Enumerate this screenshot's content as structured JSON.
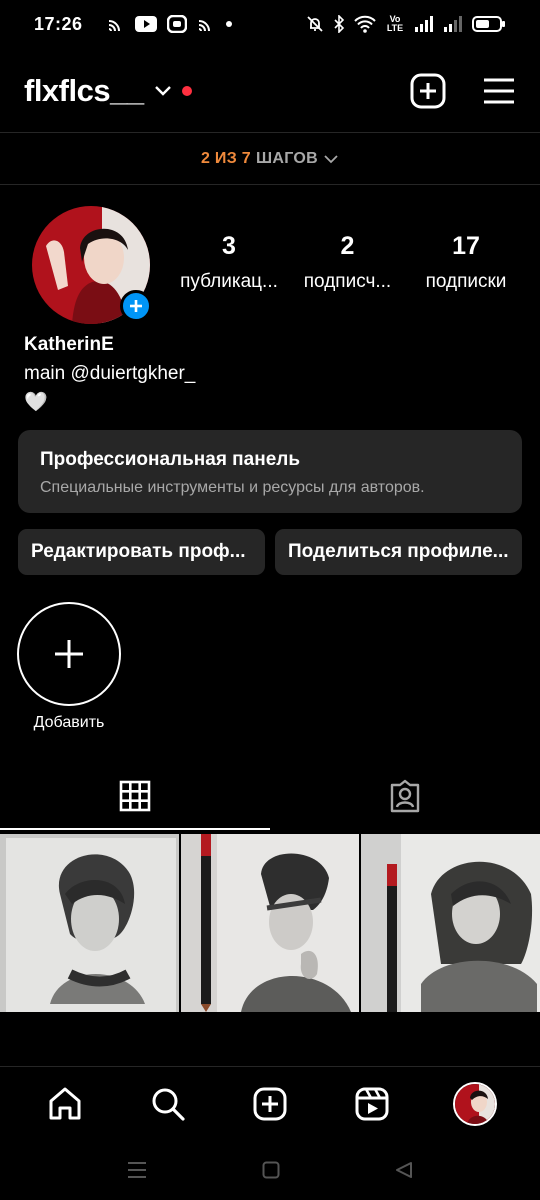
{
  "status_bar": {
    "time": "17:26",
    "left_icons": [
      "cast-icon",
      "youtube-icon",
      "vpn-icon",
      "cast-icon",
      "dot-icon"
    ],
    "right_icons": [
      "mute-icon",
      "bluetooth-icon",
      "wifi-icon",
      "volte-icon",
      "signal-icon",
      "signal-icon",
      "battery-icon"
    ],
    "volte_label": "Vo LTE"
  },
  "header": {
    "username": "flxflcs__",
    "has_notification_dot": true,
    "icons": [
      "chevron-down-icon",
      "new-post-icon",
      "menu-icon"
    ]
  },
  "steps": {
    "progress": "2 ИЗ 7",
    "label": "ШАГОВ"
  },
  "profile": {
    "stats": [
      {
        "value": "3",
        "label": "публикац..."
      },
      {
        "value": "2",
        "label": "подписч..."
      },
      {
        "value": "17",
        "label": "подписки"
      }
    ],
    "name": "KatherinE",
    "bio_line": "main @duiertgkher_",
    "bio_emoji": "🤍"
  },
  "pro_panel": {
    "title": "Профессиональная панель",
    "subtitle": "Специальные инструменты и ресурсы для авторов."
  },
  "buttons": {
    "edit": "Редактировать проф...",
    "share": "Поделиться профиле..."
  },
  "highlights": {
    "add_label": "Добавить"
  },
  "tabs": [
    "grid-icon",
    "tagged-icon"
  ],
  "posts": [
    {
      "kind": "pencil-portrait"
    },
    {
      "kind": "pencil-portrait-with-pencil"
    },
    {
      "kind": "pencil-portrait-with-pencil"
    }
  ],
  "bottom_nav": [
    "home-icon",
    "search-icon",
    "create-icon",
    "reels-icon",
    "profile-avatar"
  ],
  "colors": {
    "background": "#000000",
    "surface": "#262626",
    "accent_blue": "#0095f6",
    "notification_red": "#ff3040",
    "steps_orange": "#f08a3c",
    "muted_text": "#a8a8a8"
  }
}
